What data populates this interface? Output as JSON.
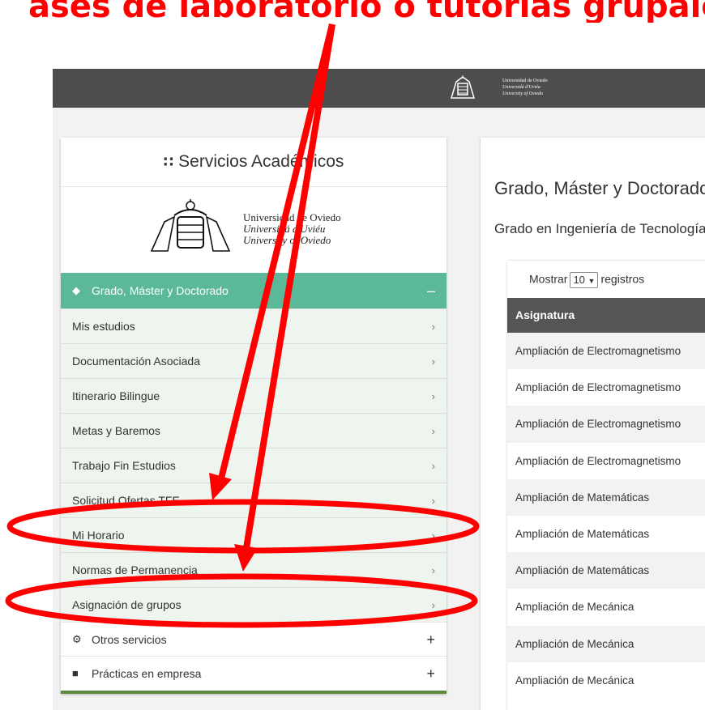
{
  "caption": "ases de laboratorio o tutorías grupales, etc.",
  "topbar": {
    "university_names": [
      "Universidad de Oviedo",
      "Universidá d'Uviéu",
      "University of Oviedo"
    ]
  },
  "sidebar": {
    "title": "Servicios Académicos",
    "university_names": [
      "Universidad de Oviedo",
      "Universidá d'Uviéu",
      "University of Oviedo"
    ],
    "section_header": "Grado, Máster y Doctorado",
    "menu_items": [
      {
        "label": "Mis estudios"
      },
      {
        "label": "Documentación Asociada"
      },
      {
        "label": "Itinerario Bilingue"
      },
      {
        "label": "Metas y Baremos"
      },
      {
        "label": "Trabajo Fin Estudios"
      },
      {
        "label": "Solicitud Ofertas TFE"
      },
      {
        "label": "Mi Horario"
      },
      {
        "label": "Normas de Permanencia"
      },
      {
        "label": "Asignación de grupos"
      }
    ],
    "other_sections": [
      {
        "label": "Otros servicios",
        "icon": "gear-icon"
      },
      {
        "label": "Prácticas en empresa",
        "icon": "briefcase-icon"
      }
    ]
  },
  "main": {
    "title": "Grado, Máster y Doctorado",
    "subtitle": "Grado en Ingeniería de Tecnologías",
    "table": {
      "show_prefix": "Mostrar",
      "show_value": "10",
      "show_suffix": "registros",
      "header": "Asignatura",
      "rows": [
        "Ampliación de Electromagnetismo",
        "Ampliación de Electromagnetismo",
        "Ampliación de Electromagnetismo",
        "Ampliación de Electromagnetismo",
        "Ampliación de Matemáticas",
        "Ampliación de Matemáticas",
        "Ampliación de Matemáticas",
        "Ampliación de Mecánica",
        "Ampliación de Mecánica",
        "Ampliación de Mecánica"
      ]
    }
  },
  "colors": {
    "annotation": "#ff0000",
    "section_header_bg": "#5bb99a",
    "menu_bg": "#eef5ee",
    "topbar_bg": "#4d4d4d",
    "table_head_bg": "#555555"
  }
}
